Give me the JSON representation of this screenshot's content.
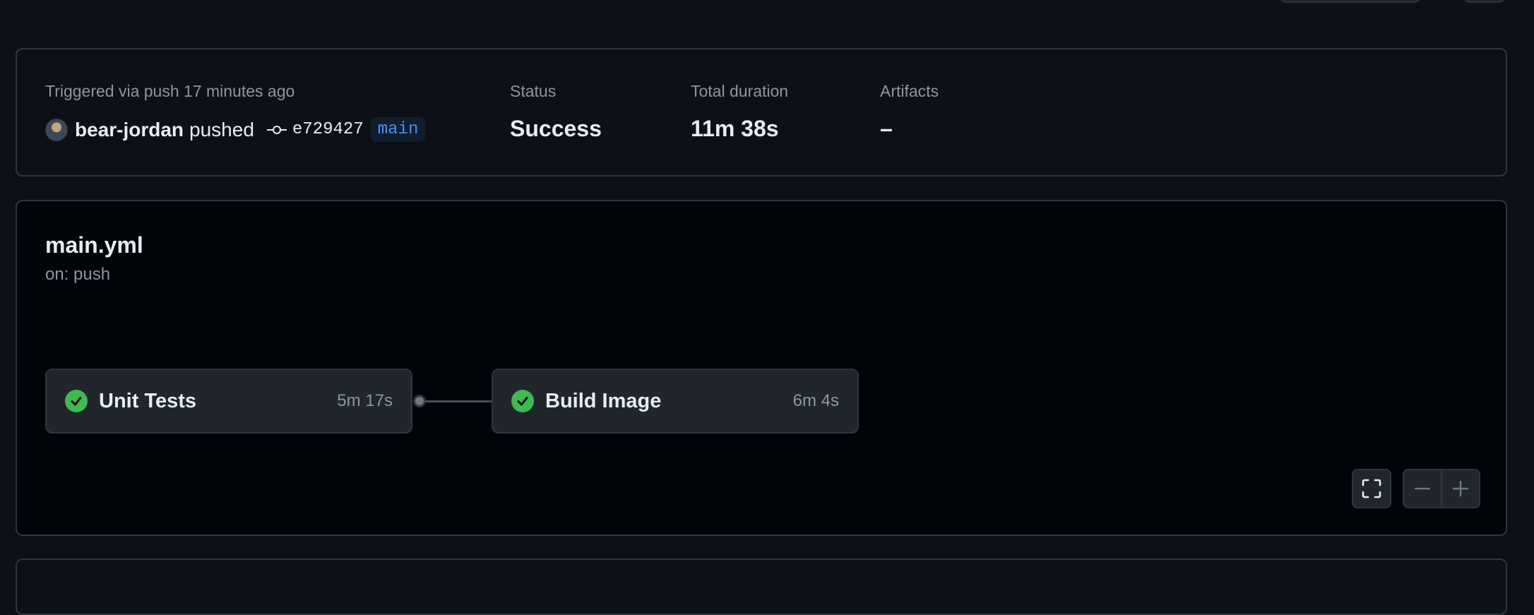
{
  "summary": {
    "trigger_text": "Triggered via push 17 minutes ago",
    "actor": "bear-jordan",
    "action": "pushed",
    "commit_sha": "e729427",
    "branch": "main",
    "status_label": "Status",
    "status_value": "Success",
    "duration_label": "Total duration",
    "duration_value": "11m 38s",
    "artifacts_label": "Artifacts",
    "artifacts_value": "–"
  },
  "workflow": {
    "file": "main.yml",
    "trigger": "on: push",
    "jobs": [
      {
        "name": "Unit Tests",
        "duration": "5m 17s",
        "status": "success"
      },
      {
        "name": "Build Image",
        "duration": "6m 4s",
        "status": "success"
      }
    ]
  },
  "controls": {
    "fullscreen_icon": "fullscreen-icon",
    "zoom_out_icon": "minus-icon",
    "zoom_in_icon": "plus-icon"
  },
  "colors": {
    "success": "#3fb950",
    "branch": "#4493f8"
  }
}
